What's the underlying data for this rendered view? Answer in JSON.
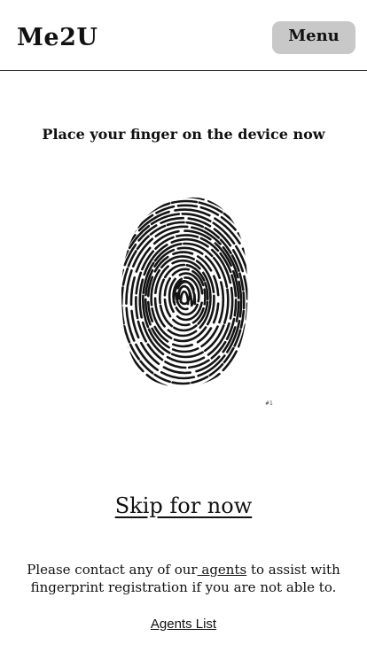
{
  "header": {
    "logo": "Me2U",
    "menu_label": "Menu"
  },
  "main": {
    "instruction": "Place your finger on the device now",
    "fingerprint_icon": "fingerprint-icon",
    "image_tag": "#1",
    "skip_label": "Skip for now",
    "contact": {
      "before": "Please contact any of our",
      "link": " agents",
      "after": " to assist with fingerprint registration if you are not able to."
    },
    "agents_list_label": "Agents List"
  },
  "colors": {
    "menu_button_bg": "#c8c8c8",
    "text": "#111111",
    "background": "#ffffff"
  }
}
